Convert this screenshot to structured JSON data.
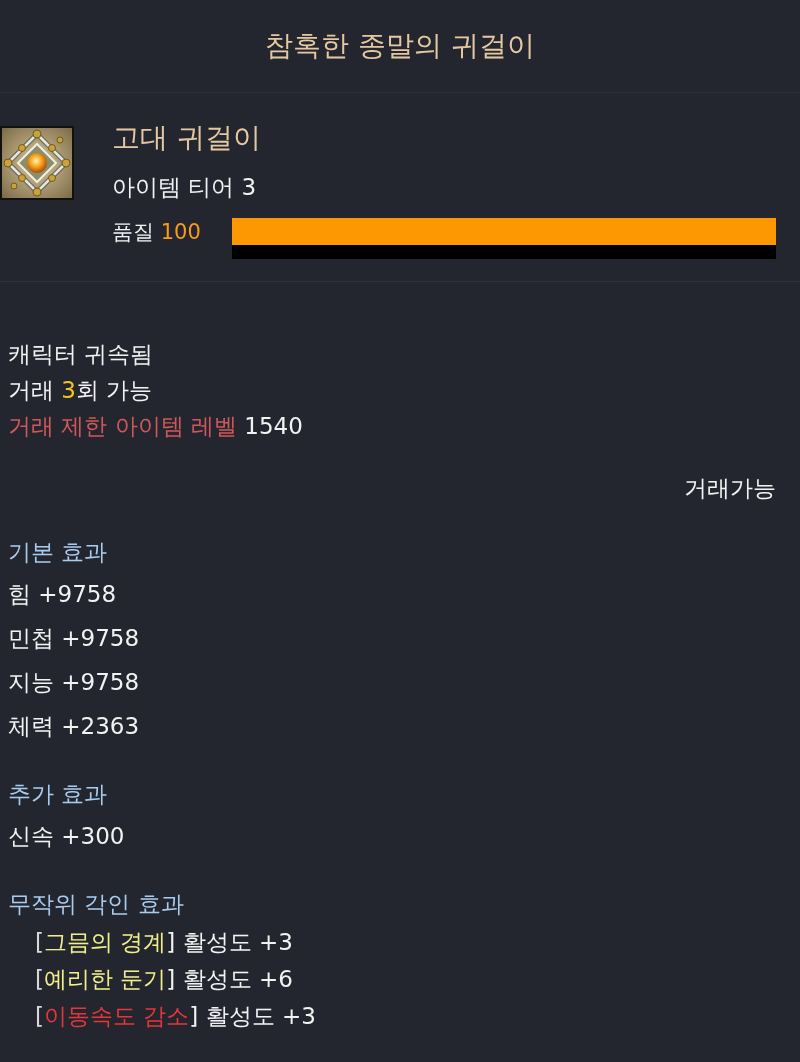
{
  "title": "참혹한 종말의 귀걸이",
  "item": {
    "grade": "고대 귀걸이",
    "tier": "아이템 티어 3",
    "quality": {
      "label": "품질",
      "value": "100",
      "level": 1
    }
  },
  "info_lines": [
    {
      "segments": [
        {
          "kind": "plain",
          "text": "캐릭터 귀속됨"
        }
      ]
    },
    {
      "segments": [
        {
          "kind": "plain",
          "text": "거래 "
        },
        {
          "kind": "count",
          "text": "3"
        },
        {
          "kind": "plain",
          "text": "회 가능"
        }
      ]
    },
    {
      "segments": [
        {
          "kind": "restriction",
          "text": "거래 제한 아이템 레벨"
        },
        {
          "kind": "plain",
          "text": " 1540"
        }
      ]
    }
  ],
  "trade_status": "거래가능",
  "sections": [
    {
      "kind": "stats",
      "title": "기본 효과",
      "lines": [
        "힘 +9758",
        "민첩 +9758",
        "지능 +9758",
        "체력 +2363"
      ]
    },
    {
      "kind": "stats",
      "title": "추가 효과",
      "lines": [
        "신속 +300"
      ]
    },
    {
      "kind": "engravings",
      "title": "무작위 각인 효과",
      "lines": [
        {
          "segments": [
            {
              "kind": "bracket",
              "text": "["
            },
            {
              "kind": "engraving",
              "text": "그믐의 경계"
            },
            {
              "kind": "plain",
              "text": "] 활성도 +3"
            }
          ]
        },
        {
          "segments": [
            {
              "kind": "bracket",
              "text": "["
            },
            {
              "kind": "engraving",
              "text": "예리한 둔기"
            },
            {
              "kind": "plain",
              "text": "] 활성도 +6"
            }
          ]
        },
        {
          "segments": [
            {
              "kind": "bracket",
              "text": "["
            },
            {
              "kind": "penalty",
              "text": "이동속도 감소"
            },
            {
              "kind": "plain",
              "text": "] 활성도 +3"
            }
          ]
        }
      ]
    }
  ]
}
